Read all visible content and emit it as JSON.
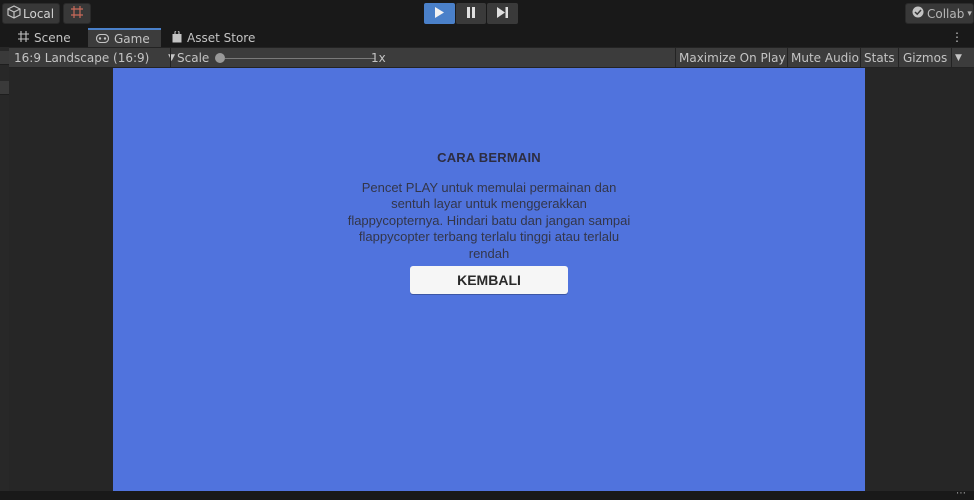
{
  "toolbar": {
    "account_label": "Local",
    "collab_label": "Collab"
  },
  "tabs": [
    {
      "label": "Scene"
    },
    {
      "label": "Game"
    },
    {
      "label": "Asset Store"
    }
  ],
  "game_toolbar": {
    "aspect": "16:9 Landscape (16:9)",
    "scale_label": "Scale",
    "scale_value": "1x",
    "scale_fraction": 0,
    "maximize_on_play": "Maximize On Play",
    "mute_audio": "Mute Audio",
    "stats": "Stats",
    "gizmos": "Gizmos"
  },
  "game_view": {
    "title": "CARA BERMAIN",
    "description": "Pencet PLAY untuk memulai permainan dan sentuh layar untuk menggerakkan flappycopternya. Hindari batu dan jangan sampai flappycopter terbang terlalu tinggi atau terlalu rendah",
    "button_label": "KEMBALI",
    "background_color": "#5073dd"
  },
  "colors": {
    "accent": "#4a80c9",
    "editor_bg": "#191919",
    "panel_bg": "#3c3c3c"
  }
}
